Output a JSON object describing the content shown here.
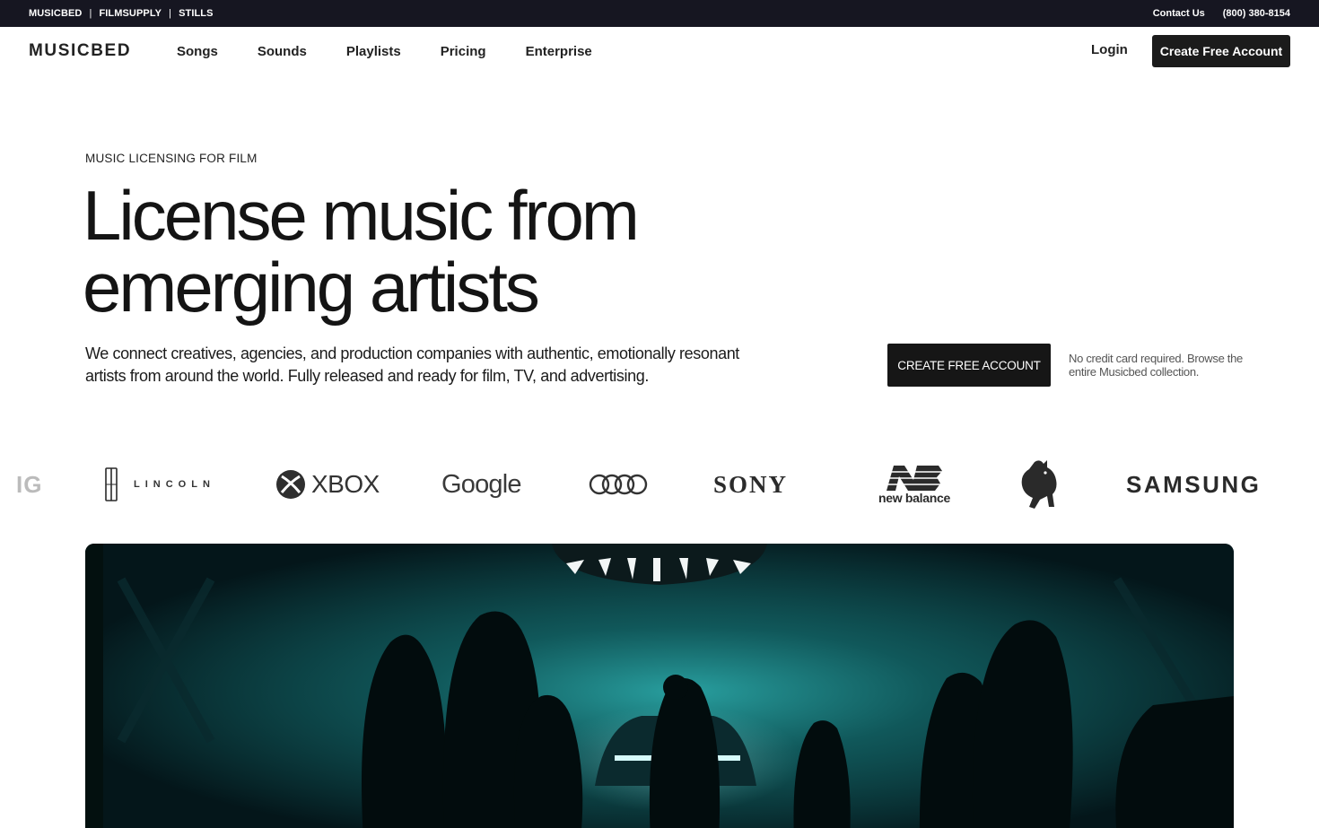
{
  "util_bar": {
    "brands": [
      "MUSICBED",
      "FILMSUPPLY",
      "STILLS"
    ],
    "separator": "|",
    "contact_label": "Contact Us",
    "phone": "(800) 380-8154"
  },
  "nav": {
    "logo": "MUSICBED",
    "items": [
      "Songs",
      "Sounds",
      "Playlists",
      "Pricing",
      "Enterprise"
    ],
    "login_label": "Login",
    "cta_label": "Create Free Account"
  },
  "hero": {
    "eyebrow": "MUSIC LICENSING FOR FILM",
    "headline_line1": "License music from",
    "headline_line2": "emerging artists",
    "subcopy": "We connect creatives, agencies, and production companies with authentic, emotionally resonant artists from around the world. Fully released and ready for film, TV, and advertising.",
    "cta_label": "CREATE FREE ACCOUNT",
    "cta_note": "No credit card required. Browse the entire Musicbed collection."
  },
  "logos": {
    "cut_off": "IG",
    "lincoln": "LINCOLN",
    "xbox": "XBOX",
    "google": "Google",
    "sony": "SONY",
    "new_balance": "new balance",
    "samsung": "SAMSUNG"
  },
  "icons": {
    "lincoln": "lincoln-star-icon",
    "xbox": "xbox-sphere-icon",
    "audi": "audi-rings-icon",
    "new_balance": "nb-monogram-icon",
    "lamborghini": "lamborghini-bull-icon"
  },
  "colors": {
    "util_bar_bg": "#161621",
    "button_bg": "#1b1b1b",
    "video_teal": "#2aa6a6"
  }
}
